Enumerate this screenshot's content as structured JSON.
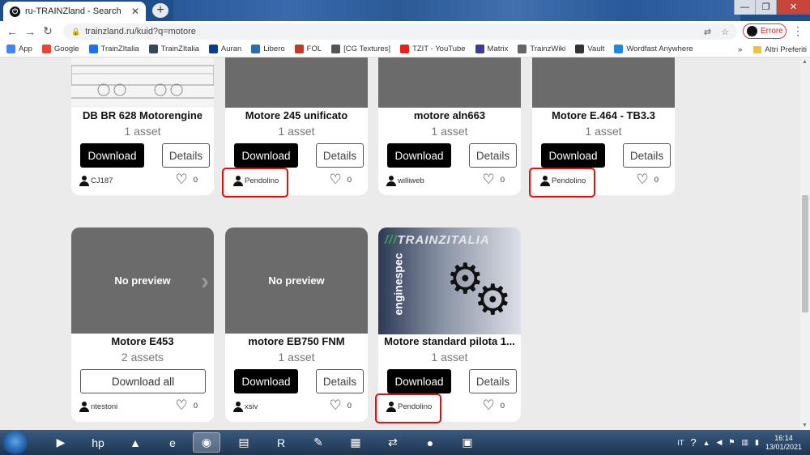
{
  "browser": {
    "tab_title": "ru-TRAINZland - Search",
    "tab_close": "✕",
    "newtab": "+",
    "url": "trainzland.ru/kuid?q=motore",
    "profile_status": "Errore",
    "window_min": "—",
    "window_max": "❐",
    "window_close": "✕"
  },
  "bookmarks": [
    {
      "label": "App",
      "icon": "apps-grid-icon",
      "color": "#4285f4"
    },
    {
      "label": "Google",
      "icon": "google-icon",
      "color": "#ea4335"
    },
    {
      "label": "TrainZItalia",
      "icon": "trainzitalia-icon",
      "color": "#1a73e8"
    },
    {
      "label": "TrainZItalia",
      "icon": "trainzitalia-icon",
      "color": "#34495e"
    },
    {
      "label": "Auran",
      "icon": "auran-icon",
      "color": "#0a3d91"
    },
    {
      "label": "Libero",
      "icon": "libero-icon",
      "color": "#2c6cb0"
    },
    {
      "label": "FOL",
      "icon": "fol-icon",
      "color": "#c0392b"
    },
    {
      "label": "[CG Textures]",
      "icon": "cgtextures-icon",
      "color": "#555555"
    },
    {
      "label": "TZIT - YouTube",
      "icon": "youtube-icon",
      "color": "#e62117"
    },
    {
      "label": "Matrix",
      "icon": "matrix-icon",
      "color": "#3b3b98"
    },
    {
      "label": "TrainzWiki",
      "icon": "trainzwiki-icon",
      "color": "#666666"
    },
    {
      "label": "Vault",
      "icon": "vault-icon",
      "color": "#333333"
    },
    {
      "label": "Wordfast Anywhere",
      "icon": "wordfast-icon",
      "color": "#1e88e5"
    }
  ],
  "bookmarks_more": "»",
  "bookmarks_other": "Altri Preferiti",
  "cards": [
    {
      "title": "DB BR 628 Motorengine",
      "count": "1 asset",
      "image": "DB BR 628 drawing",
      "primary": "Download",
      "secondary": "Details",
      "author": "CJ187",
      "likes": "0",
      "highlight": false
    },
    {
      "title": "Motore 245 unificato",
      "count": "1 asset",
      "image": "",
      "primary": "Download",
      "secondary": "Details",
      "author": "Pendolino",
      "likes": "0",
      "highlight": true
    },
    {
      "title": "motore aln663",
      "count": "1 asset",
      "image": "",
      "primary": "Download",
      "secondary": "Details",
      "author": "williweb",
      "likes": "0",
      "highlight": false
    },
    {
      "title": "Motore E.464 - TB3.3",
      "count": "1 asset",
      "image": "",
      "primary": "Download",
      "secondary": "Details",
      "author": "Pendolino",
      "likes": "0",
      "highlight": true
    },
    {
      "title": "Motore E453",
      "count": "2 assets",
      "image": "No preview",
      "primary": "Download all",
      "secondary": "",
      "author": "ntestoni",
      "likes": "0",
      "highlight": false
    },
    {
      "title": "motore EB750 FNM",
      "count": "1 asset",
      "image": "No preview",
      "primary": "Download",
      "secondary": "Details",
      "author": "xsiv",
      "likes": "0",
      "highlight": false
    },
    {
      "title": "Motore standard pilota 1...",
      "count": "1 asset",
      "image": "TRAINZITALIA enginespec",
      "primary": "Download",
      "secondary": "Details",
      "author": "Pendolino",
      "likes": "0",
      "highlight": true
    }
  ],
  "card3_logo": "TRAINZITALIA",
  "card3_spec": "enginespec",
  "taskbar": {
    "lang": "IT",
    "time": "16:14",
    "date": "13/01/2021"
  },
  "colors": {
    "highlight": "#e01010",
    "primary_button": "#000000",
    "page_bg": "#ebebeb"
  }
}
